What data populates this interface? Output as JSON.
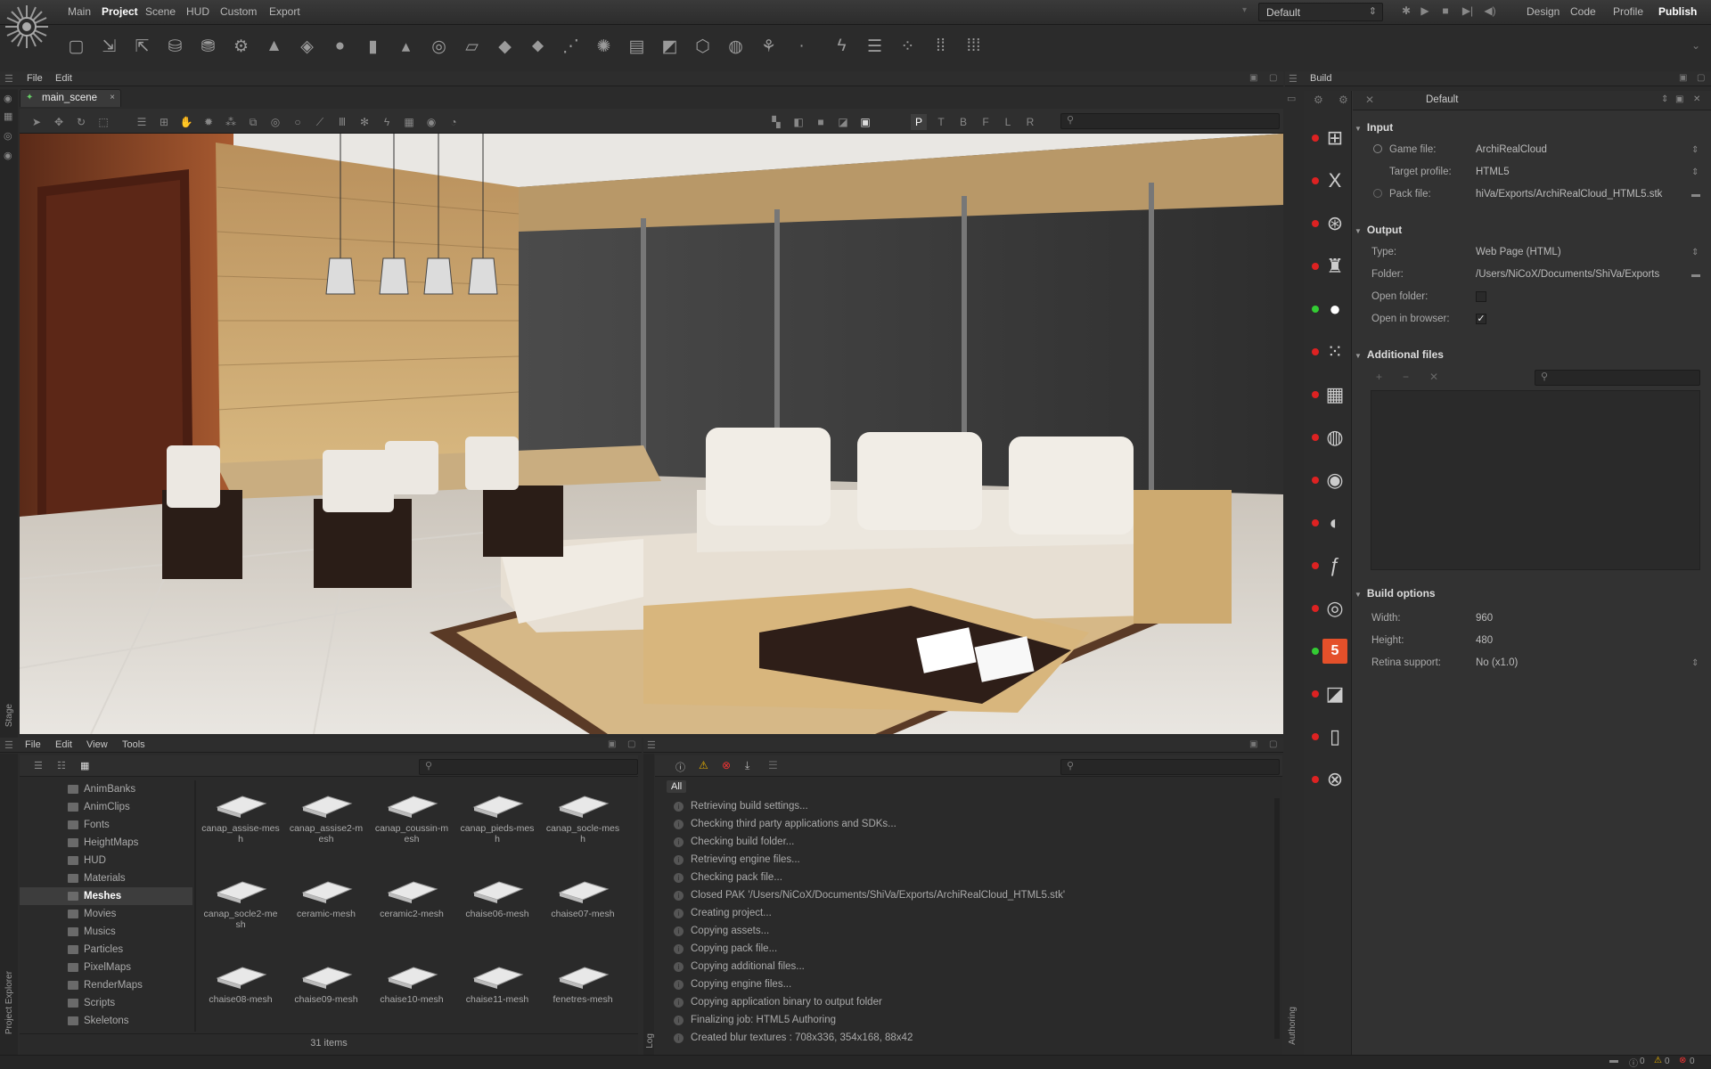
{
  "menu": {
    "items": [
      "Main",
      "Project",
      "Scene",
      "HUD",
      "Custom",
      "Export"
    ],
    "active": "Project"
  },
  "profile": {
    "selected": "Default"
  },
  "modes": {
    "items": [
      "Design",
      "Code",
      "Profile",
      "Publish"
    ],
    "active": "Publish"
  },
  "toolbar": {
    "icons": [
      "new-game-icon",
      "import-icon",
      "export-icon",
      "database-add-icon",
      "database-icon",
      "gear-icon",
      "terrain-icon",
      "cube-icon",
      "sphere-icon",
      "cylinder-icon",
      "cone-icon",
      "torus-icon",
      "plane-icon",
      "diamond-icon",
      "flat-diamond-icon",
      "rain-icon",
      "sun-icon",
      "film-icon",
      "square-icon",
      "box-outline-icon",
      "globe-icon",
      "camera-icon",
      "dot-icon",
      "lightning-icon",
      "sliders-icon",
      "molecule-icon",
      "grid-icon",
      "grid-alt-icon"
    ]
  },
  "stage": {
    "menu": [
      "File",
      "Edit"
    ],
    "tab": "main_scene",
    "side_label": "Stage",
    "view_letters": [
      "P",
      "T",
      "B",
      "F",
      "L",
      "R"
    ]
  },
  "build": {
    "title": "Build",
    "profile": "Default",
    "side_label": "Authoring",
    "input": {
      "title": "Input",
      "game_file_label": "Game file:",
      "game_file": "ArchiRealCloud",
      "target_profile_label": "Target profile:",
      "target_profile": "HTML5",
      "pack_file_label": "Pack file:",
      "pack_file": "hiVa/Exports/ArchiRealCloud_HTML5.stk"
    },
    "output": {
      "title": "Output",
      "type_label": "Type:",
      "type": "Web Page (HTML)",
      "folder_label": "Folder:",
      "folder": "/Users/NiCoX/Documents/ShiVa/Exports",
      "open_folder_label": "Open folder:",
      "open_browser_label": "Open in browser:"
    },
    "additional": {
      "title": "Additional files"
    },
    "options": {
      "title": "Build options",
      "width_label": "Width:",
      "width": "960",
      "height_label": "Height:",
      "height": "480",
      "retina_label": "Retina support:",
      "retina": "No (x1.0)"
    },
    "platforms": [
      {
        "icon": "windows-icon",
        "status": "red"
      },
      {
        "icon": "x-icon",
        "status": "red"
      },
      {
        "icon": "ubuntu-icon",
        "status": "red"
      },
      {
        "icon": "android-icon",
        "status": "red"
      },
      {
        "icon": "apple-icon",
        "status": "green"
      },
      {
        "icon": "blackberry-icon",
        "status": "red"
      },
      {
        "icon": "windows8-icon",
        "status": "red"
      },
      {
        "icon": "windows-phone-icon",
        "status": "red"
      },
      {
        "icon": "unity-icon",
        "status": "red"
      },
      {
        "icon": "wii-icon",
        "status": "red"
      },
      {
        "icon": "flash-icon",
        "status": "red"
      },
      {
        "icon": "chrome-icon",
        "status": "red"
      },
      {
        "icon": "html5-icon",
        "status": "green"
      },
      {
        "icon": "marmalade-icon",
        "status": "red"
      },
      {
        "icon": "cube-icon",
        "status": "red"
      },
      {
        "icon": "xbox-icon",
        "status": "red"
      }
    ]
  },
  "explorer": {
    "menu": [
      "File",
      "Edit",
      "View",
      "Tools"
    ],
    "side_label": "Project Explorer",
    "folders": [
      "AnimBanks",
      "AnimClips",
      "Fonts",
      "HeightMaps",
      "HUD",
      "Materials",
      "Meshes",
      "Movies",
      "Musics",
      "Particles",
      "PixelMaps",
      "RenderMaps",
      "Scripts",
      "Skeletons"
    ],
    "selected_folder": "Meshes",
    "assets": [
      "canap_assise-mesh",
      "canap_assise2-mesh",
      "canap_coussin-mesh",
      "canap_pieds-mesh",
      "canap_socle-mesh",
      "canap_socle2-mesh",
      "ceramic-mesh",
      "ceramic2-mesh",
      "chaise06-mesh",
      "chaise07-mesh",
      "chaise08-mesh",
      "chaise09-mesh",
      "chaise10-mesh",
      "chaise11-mesh",
      "fenetres-mesh"
    ],
    "status": "31 items"
  },
  "log": {
    "side_label": "Log",
    "filter": "All",
    "lines": [
      "Retrieving build settings...",
      "Checking third party applications and SDKs...",
      "Checking build folder...",
      "Retrieving engine files...",
      "Checking pack file...",
      "Closed PAK '/Users/NiCoX/Documents/ShiVa/Exports/ArchiRealCloud_HTML5.stk'",
      "Creating project...",
      "Copying assets...",
      "Copying pack file...",
      "Copying additional files...",
      "Copying engine files...",
      "Copying application binary to output folder",
      "Finalizing job: HTML5 Authoring",
      "Created blur textures : 708x336, 354x168, 88x42"
    ]
  },
  "statusbar": {
    "info": "0",
    "warn": "0",
    "err": "0"
  }
}
